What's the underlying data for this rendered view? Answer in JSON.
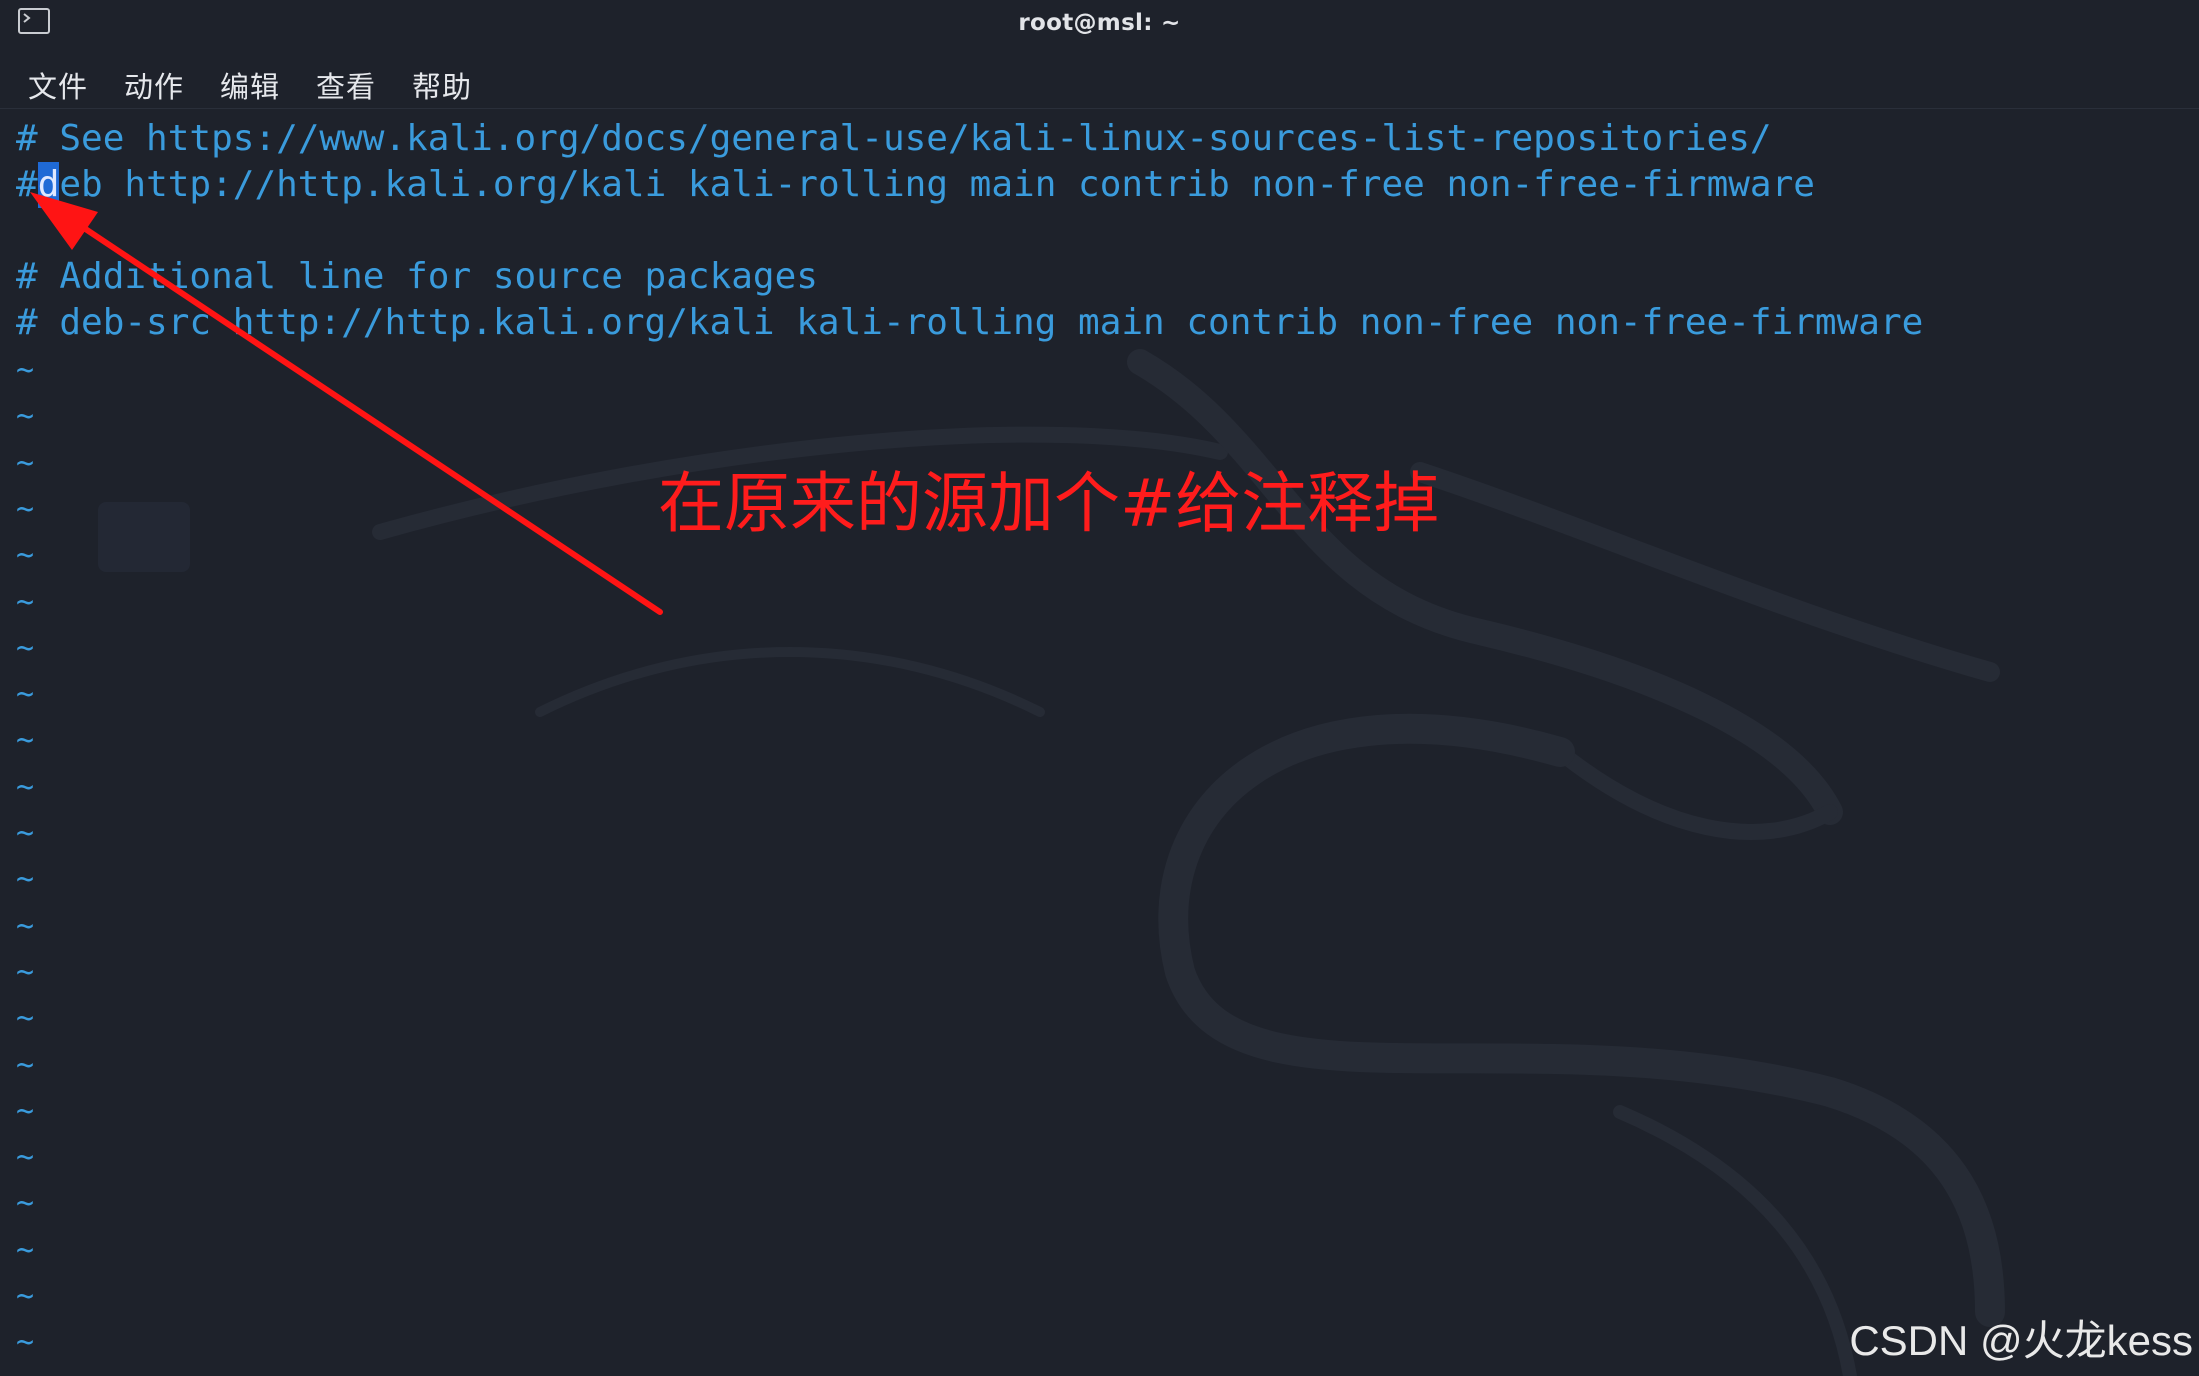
{
  "window": {
    "title": "root@msl: ~",
    "icon": "terminal-icon"
  },
  "menu": [
    "文件",
    "动作",
    "编辑",
    "查看",
    "帮助"
  ],
  "editor": {
    "lines": [
      {
        "prefix": "",
        "cursor": "",
        "rest": "# See https://www.kali.org/docs/general-use/kali-linux-sources-list-repositories/"
      },
      {
        "prefix": "#",
        "cursor": "d",
        "rest": "eb http://http.kali.org/kali kali-rolling main contrib non-free non-free-firmware"
      },
      {
        "prefix": "",
        "cursor": "",
        "rest": ""
      },
      {
        "prefix": "",
        "cursor": "",
        "rest": "# Additional line for source packages"
      },
      {
        "prefix": "",
        "cursor": "",
        "rest": "# deb-src http://http.kali.org/kali kali-rolling main contrib non-free non-free-firmware"
      }
    ],
    "empty_line_marker": "~",
    "empty_line_count": 22
  },
  "annotation": {
    "text": "在原来的源加个#给注释掉",
    "color": "#ff1c1c"
  },
  "watermark": "CSDN @火龙kess",
  "colors": {
    "background": "#1e222b",
    "text": "#3a9bdc",
    "cursor": "#1f6ad6",
    "annotation": "#ff1c1c"
  }
}
